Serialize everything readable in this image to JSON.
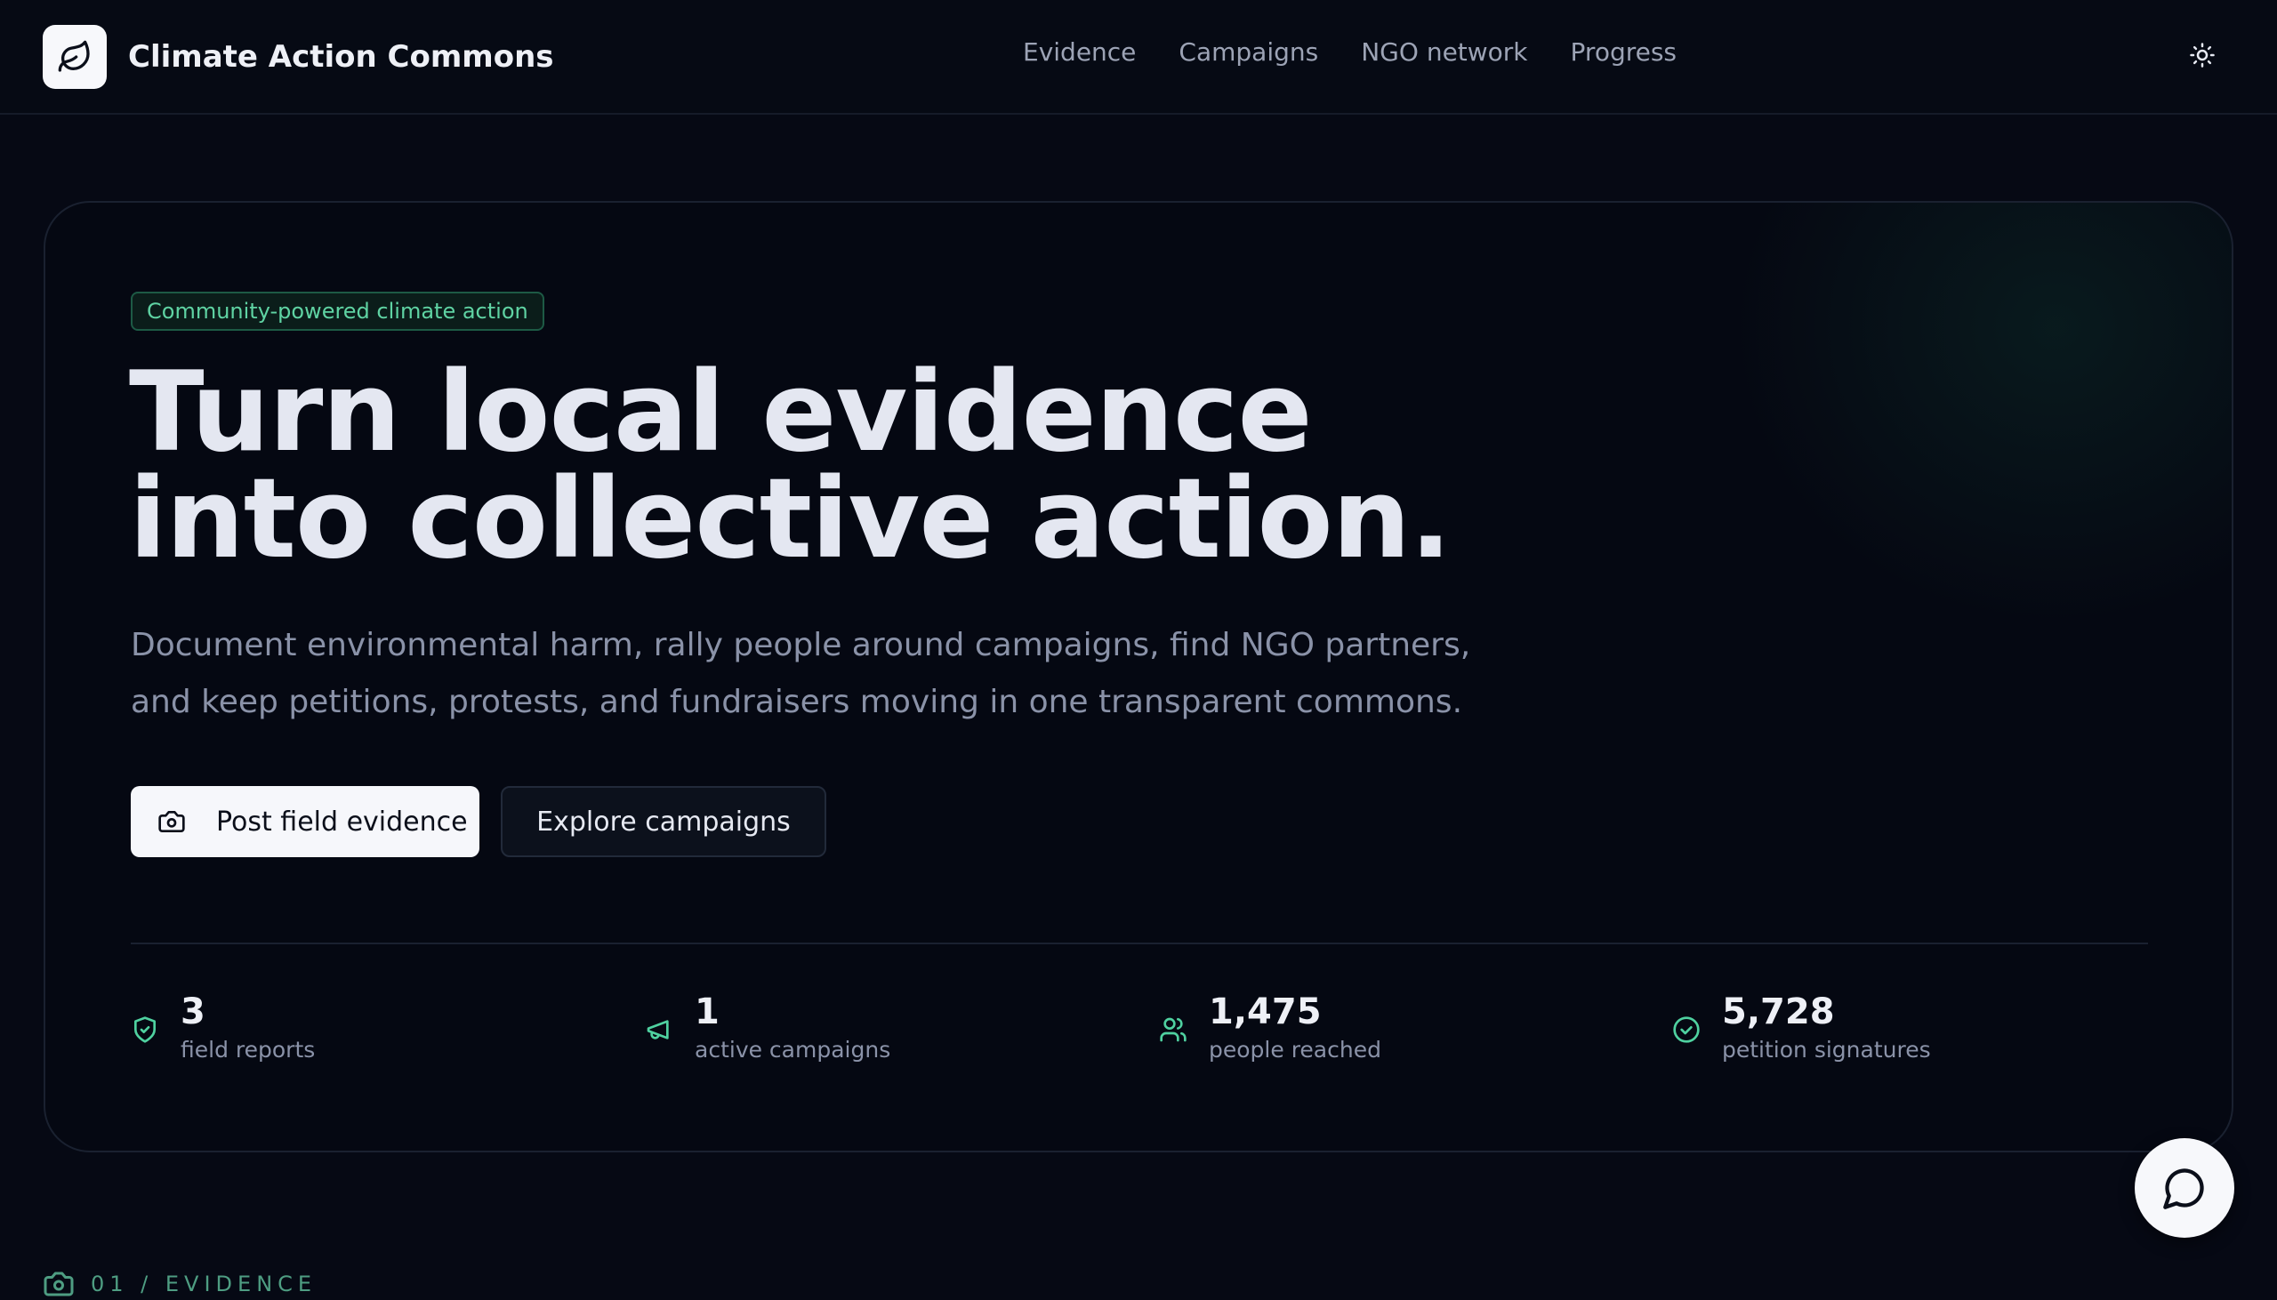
{
  "app": {
    "name": "Climate Action Commons",
    "logo_icon": "leaf-icon"
  },
  "nav": {
    "items": [
      "Evidence",
      "Campaigns",
      "NGO network",
      "Progress"
    ]
  },
  "header": {
    "theme_icon": "sun-icon"
  },
  "hero": {
    "badge": "Community-powered climate action",
    "headline_line1": "Turn local evidence",
    "headline_line2": "into collective action.",
    "subtext_line1": "Document environmental harm, rally people around campaigns, find NGO partners,",
    "subtext_line2": "and keep petitions, protests, and fundraisers moving in one transparent commons.",
    "primary_button": {
      "label": "Post field evidence",
      "icon": "camera-icon"
    },
    "secondary_button": {
      "label": "Explore campaigns"
    }
  },
  "stats": [
    {
      "value": "3",
      "label": "field reports",
      "icon": "shield-check-icon"
    },
    {
      "value": "1",
      "label": "active campaigns",
      "icon": "megaphone-icon"
    },
    {
      "value": "1,475",
      "label": "people reached",
      "icon": "users-icon"
    },
    {
      "value": "5,728",
      "label": "petition signatures",
      "icon": "check-circle-icon"
    }
  ],
  "section": {
    "label": "01 / EVIDENCE",
    "icon": "camera-icon"
  },
  "colors": {
    "accent": "#4fd1a0",
    "background": "#060914",
    "text": "#e6e9f2",
    "muted": "#8a92a8"
  }
}
